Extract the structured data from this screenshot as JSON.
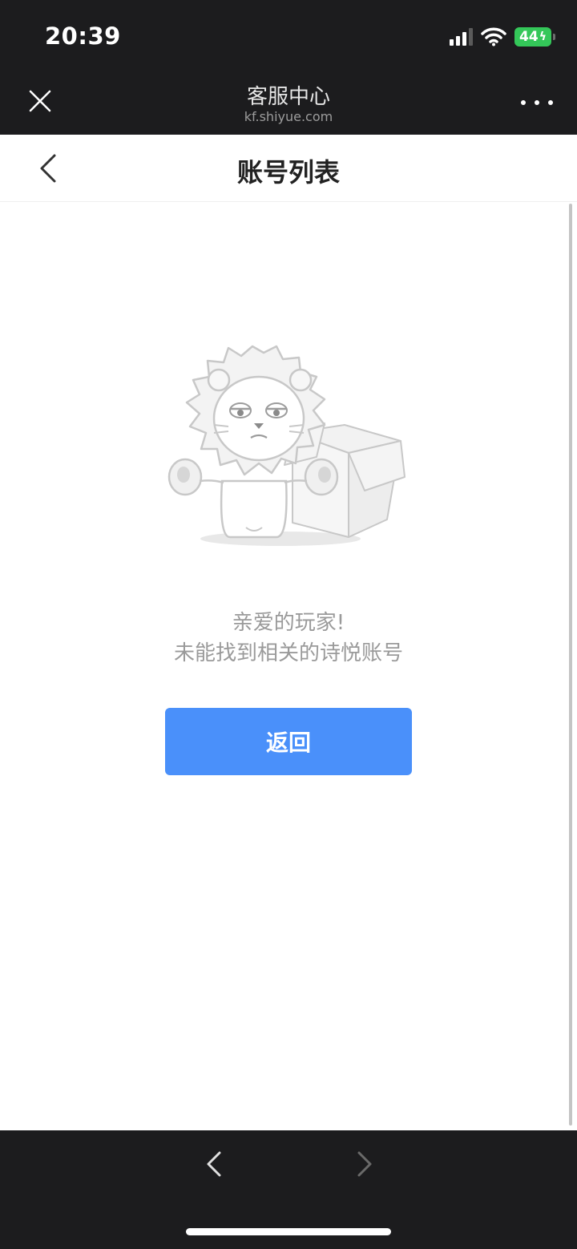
{
  "status_bar": {
    "time": "20:39",
    "battery": "44",
    "icons": [
      "signal-icon",
      "wifi-icon",
      "battery-icon"
    ]
  },
  "browser": {
    "title": "客服中心",
    "url": "kf.shiyue.com",
    "close_icon": "close-icon",
    "more_icon": "more-icon"
  },
  "header": {
    "title": "账号列表",
    "back_icon": "chevron-left-icon"
  },
  "empty_state": {
    "illustration": "lion-with-box-illustration",
    "line1": "亲爱的玩家!",
    "line2": "未能找到相关的诗悦账号"
  },
  "actions": {
    "return_label": "返回"
  },
  "bottom_nav": {
    "back_icon": "chevron-left-icon",
    "forward_icon": "chevron-right-icon"
  },
  "colors": {
    "dark_bar": "#1c1c1e",
    "primary": "#4a90fa",
    "battery": "#34c759",
    "muted_text": "#9a9a9a"
  }
}
